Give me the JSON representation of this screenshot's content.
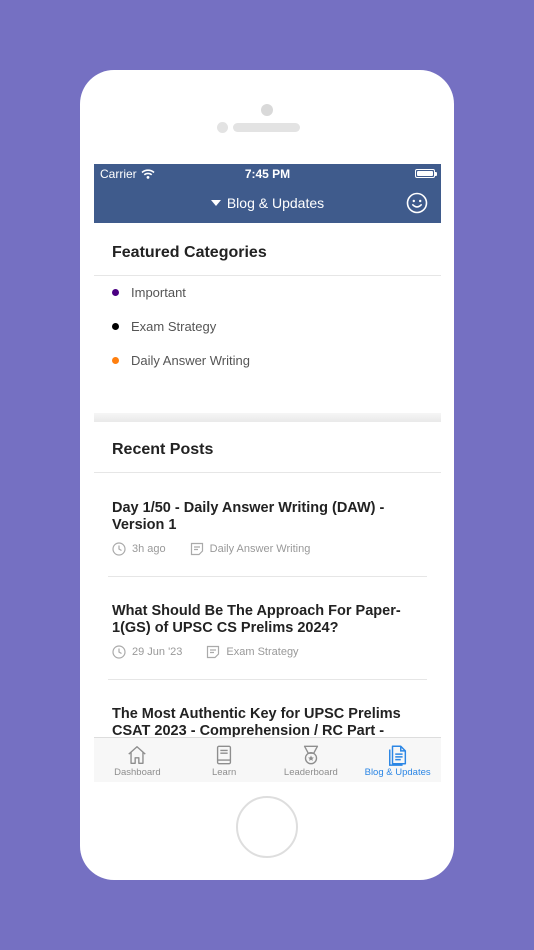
{
  "status": {
    "carrier": "Carrier",
    "time": "7:45 PM"
  },
  "header": {
    "title": "Blog & Updates",
    "smiley_icon": "smiley-icon"
  },
  "featured": {
    "title": "Featured Categories",
    "items": [
      {
        "label": "Important",
        "color": "#4b0082"
      },
      {
        "label": "Exam Strategy",
        "color": "#000000"
      },
      {
        "label": "Daily Answer Writing",
        "color": "#ff7f0e"
      }
    ]
  },
  "recent": {
    "title": "Recent Posts",
    "posts": [
      {
        "title": "Day 1/50 - Daily Answer Writing (DAW) - Version 1",
        "time": "3h ago",
        "category": "Daily Answer Writing"
      },
      {
        "title": "What Should Be The Approach For Paper-1(GS) of UPSC CS Prelims 2024?",
        "time": "29 Jun '23",
        "category": "Exam Strategy"
      },
      {
        "title": "The Most Authentic Key for UPSC Prelims CSAT 2023 - Comprehension / RC Part -",
        "time": "",
        "category": ""
      }
    ]
  },
  "tabs": [
    {
      "label": "Dashboard",
      "icon": "home-icon",
      "active": false
    },
    {
      "label": "Learn",
      "icon": "book-icon",
      "active": false
    },
    {
      "label": "Leaderboard",
      "icon": "medal-icon",
      "active": false
    },
    {
      "label": "Blog & Updates",
      "icon": "blog-icon",
      "active": true
    }
  ],
  "colors": {
    "background": "#7570c2",
    "header": "#3f5b8c",
    "active_tab": "#2b86e5"
  }
}
